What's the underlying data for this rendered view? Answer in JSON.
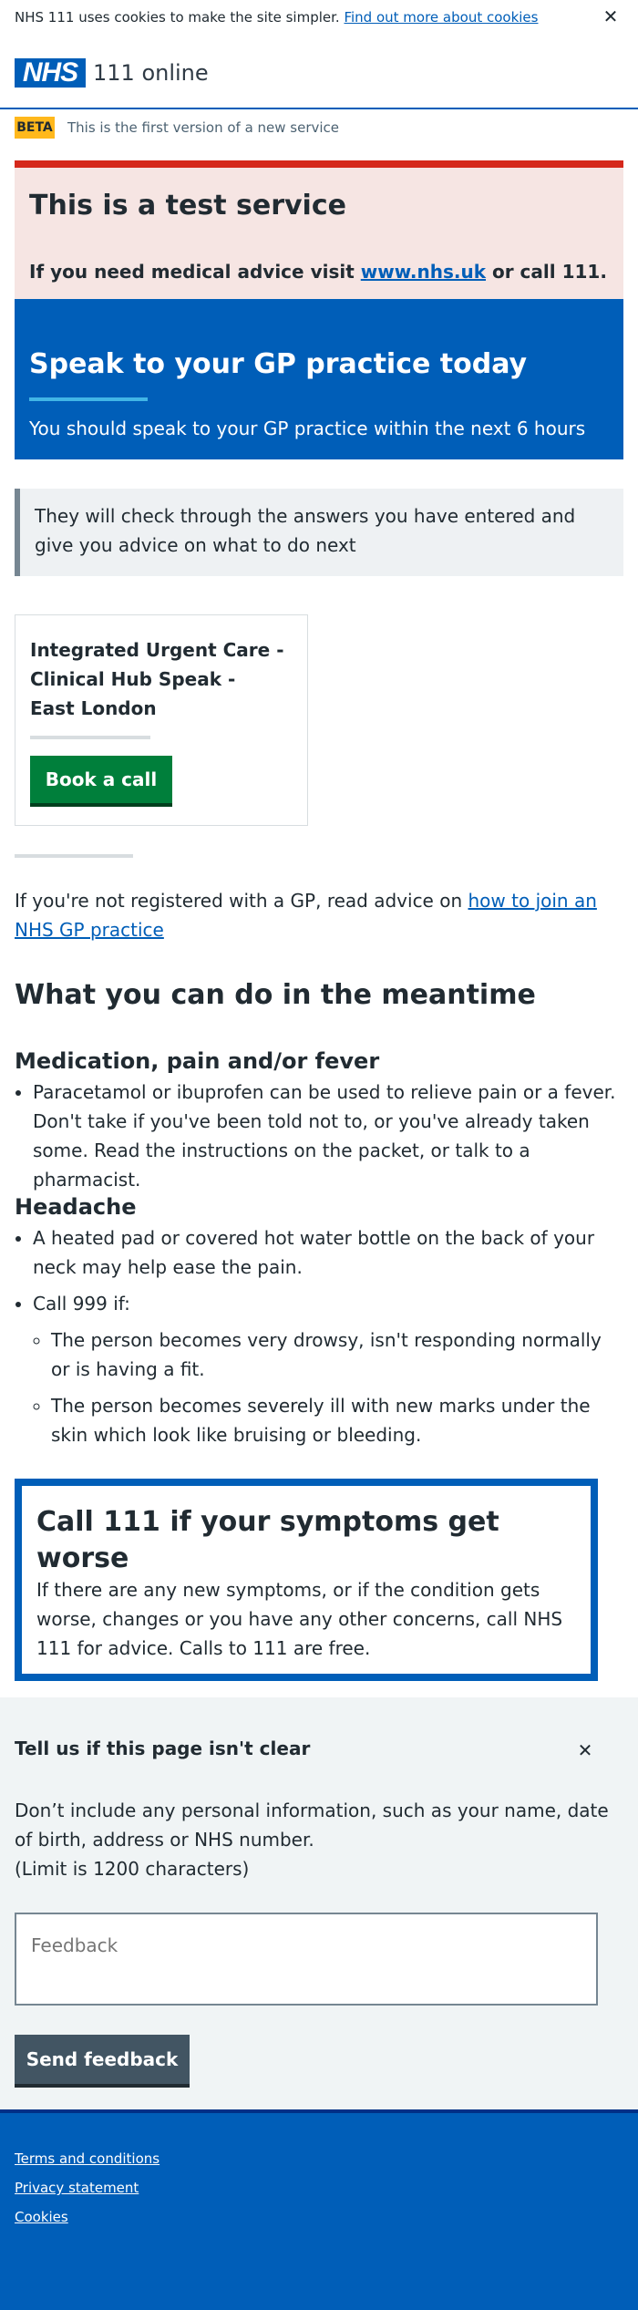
{
  "cookie_banner": {
    "text": "NHS 111 uses cookies to make the site simpler.",
    "link": "Find out more about cookies",
    "close": "✕"
  },
  "header": {
    "logo": "NHS",
    "service_name": "111 online"
  },
  "beta": {
    "tag": "BETA",
    "text": "This is the first version of a new service"
  },
  "test_banner": {
    "title": "This is a test service",
    "text_before": "If you need medical advice visit",
    "link": "www.nhs.uk",
    "text_after": "or call 111."
  },
  "care_card": {
    "title": "Speak to your GP practice today",
    "subtitle": "You should speak to your GP practice within the next 6 hours"
  },
  "inset": {
    "text": "They will check through the answers you have entered and give you advice on what to do next"
  },
  "service_card": {
    "title": "Integrated Urgent Care - Clinical Hub Speak - East London",
    "button": "Book a call"
  },
  "gp_advice": {
    "text": "If you're not registered with a GP, read advice on",
    "link": "how to join an NHS GP practice"
  },
  "meantime": {
    "title": "What you can do in the meantime",
    "medication": {
      "title": "Medication, pain and/or fever",
      "items": [
        "Paracetamol or ibuprofen can be used to relieve pain or a fever. Don't take if you've been told not to, or you've already taken some. Read the instructions on the packet, or talk to a pharmacist."
      ]
    },
    "headache": {
      "title": "Headache",
      "item1": "A heated pad or covered hot water bottle on the back of your neck may help ease the pain.",
      "item2": "Call 999 if:",
      "sub_items": [
        "The person becomes very drowsy, isn't responding normally or is having a fit.",
        "The person becomes severely ill with new marks under the skin which look like bruising or bleeding."
      ]
    }
  },
  "worse_card": {
    "title": "Call 111 if your symptoms get worse",
    "text": "If there are any new symptoms, or if the condition gets worse, changes or you have any other concerns, call NHS 111 for advice. Calls to 111 are free."
  },
  "feedback": {
    "title": "Tell us if this page isn't clear",
    "close": "✕",
    "hint_line1": "Don’t include any personal information, such as your name, date of birth, address or NHS number.",
    "hint_line2": "(Limit is 1200 characters)",
    "placeholder": "Feedback",
    "button": "Send feedback"
  },
  "footer": {
    "links": [
      "Terms and conditions",
      "Privacy statement",
      "Cookies"
    ]
  },
  "colors": {
    "nhs_blue": "#005eb8",
    "green": "#007f3b",
    "red": "#d5281b",
    "yellow": "#ffb81c",
    "grey_button": "#425563"
  }
}
